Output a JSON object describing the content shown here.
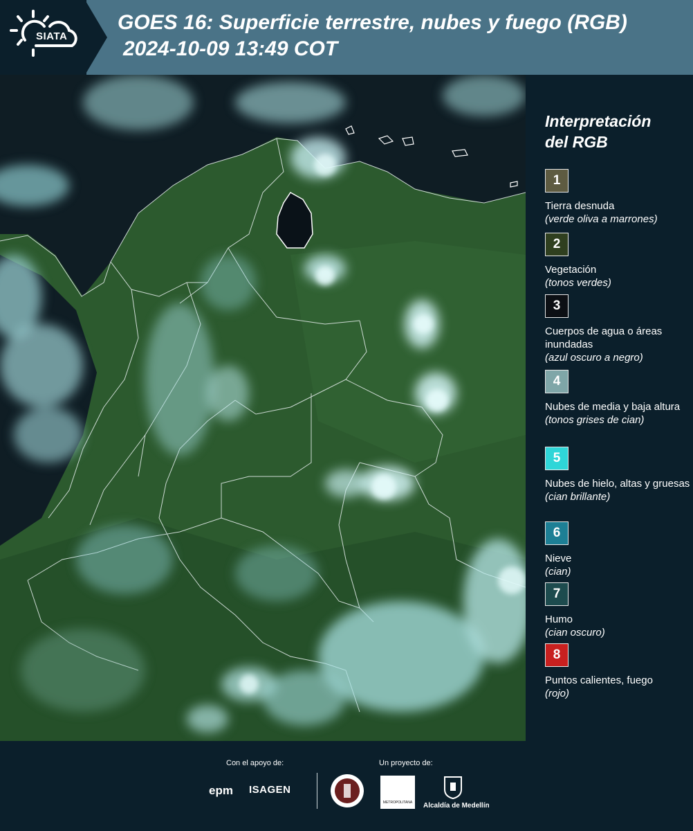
{
  "header": {
    "logo_text": "SIATA",
    "title_line1": "GOES 16: Superficie terrestre, nubes y fuego (RGB)",
    "title_line2": "2024-10-09 13:49 COT"
  },
  "legend": {
    "title_line1": "Interpretación",
    "title_line2": "del RGB",
    "items": [
      {
        "number": "1",
        "color": "#5e5b41",
        "label": "Tierra desnuda",
        "desc": "(verde oliva a marrones)"
      },
      {
        "number": "2",
        "color": "#2f3f1f",
        "label": "Vegetación",
        "desc": "(tonos verdes)"
      },
      {
        "number": "3",
        "color": "#0c0f14",
        "label": "Cuerpos de agua o áreas inundadas",
        "desc": "(azul oscuro a negro)"
      },
      {
        "number": "4",
        "color": "#7fa6a8",
        "label": "Nubes de media y baja altura",
        "desc": "(tonos grises de cian)"
      },
      {
        "number": "5",
        "color": "#2fd6d8",
        "label": "Nubes de hielo, altas y gruesas",
        "desc": "(cian brillante)"
      },
      {
        "number": "6",
        "color": "#1d7f95",
        "label": "Nieve",
        "desc": "(cian)"
      },
      {
        "number": "7",
        "color": "#1d4b4e",
        "label": "Humo",
        "desc": "(cian oscuro)"
      },
      {
        "number": "8",
        "color": "#c8201f",
        "label": "Puntos calientes, fuego",
        "desc": "(rojo)"
      }
    ]
  },
  "footer": {
    "support_label": "Con el apoyo de:",
    "project_label": "Un proyecto de:",
    "epm": "epm",
    "isagen": "ISAGEN",
    "area_text": "METROPOLITANA",
    "alcaldia": "Alcaldía de Medellín"
  },
  "colors": {
    "header_bg": "#4a7387",
    "panel_bg": "#0b1f2b",
    "ocean": "#0d1b22",
    "land": "#2c5a2e",
    "cloud": "#9fe3e6"
  }
}
